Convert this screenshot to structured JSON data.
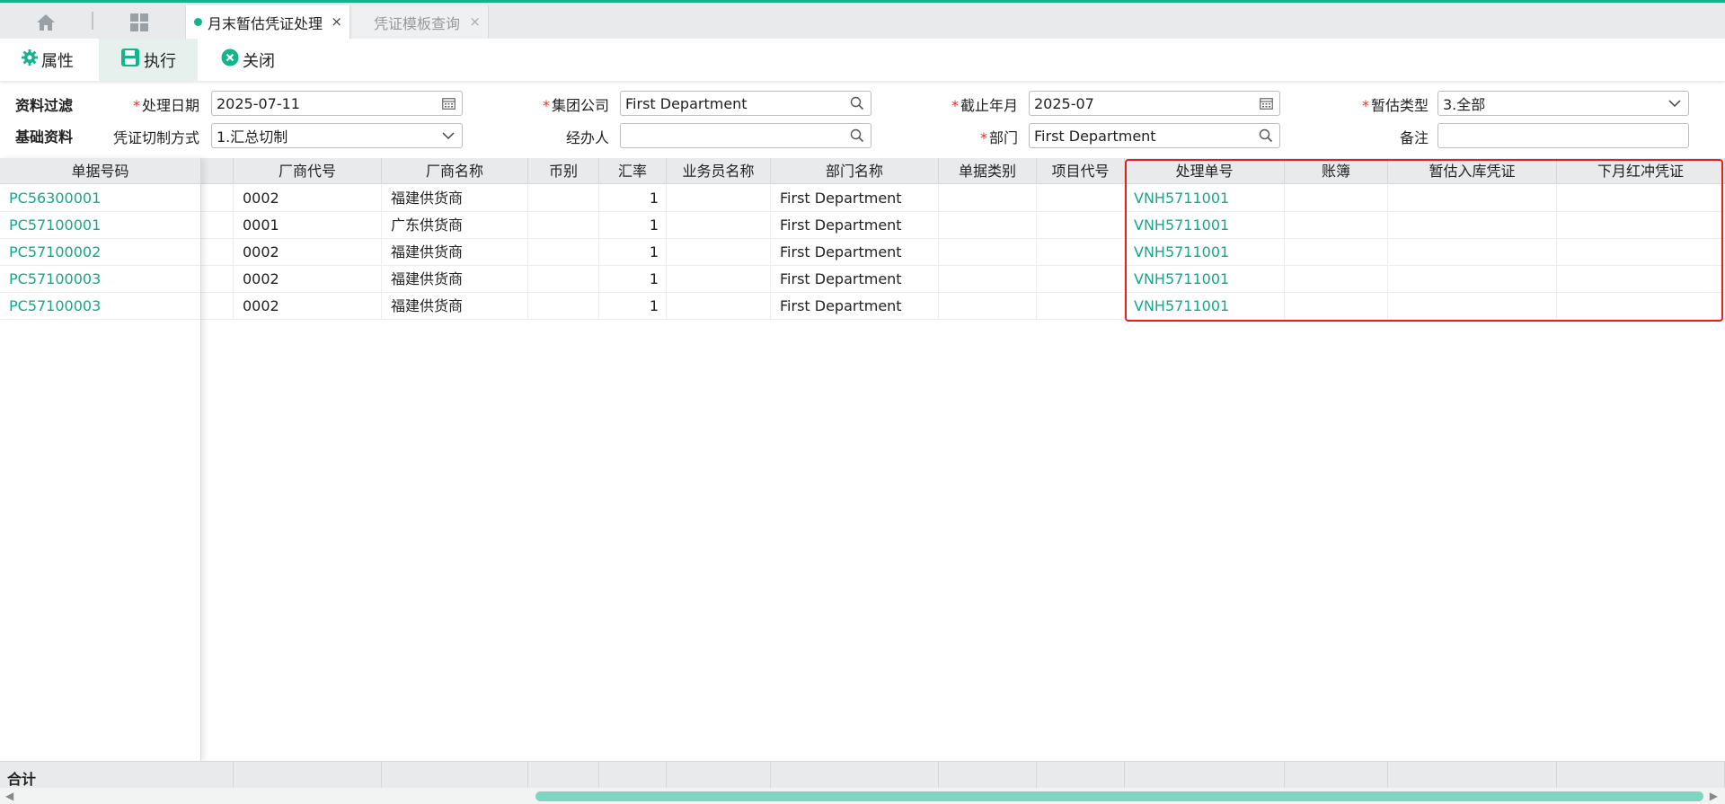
{
  "tabs": {
    "active": {
      "label": "月末暂估凭证处理",
      "close": "×"
    },
    "inactive": {
      "label": "凭证模板查询",
      "close": "×"
    }
  },
  "toolbar": {
    "properties": "属性",
    "execute": "执行",
    "close": "关闭"
  },
  "filter": {
    "section1": "资料过滤",
    "section2": "基础资料",
    "process_date": {
      "label": "处理日期",
      "value": "2025-07-11"
    },
    "group_company": {
      "label": "集团公司",
      "value": "First Department"
    },
    "cutoff_month": {
      "label": "截止年月",
      "value": "2025-07"
    },
    "estimate_type": {
      "label": "暂估类型",
      "value": "3.全部"
    },
    "voucher_mode": {
      "label": "凭证切制方式",
      "value": "1.汇总切制"
    },
    "handler": {
      "label": "经办人",
      "value": ""
    },
    "department": {
      "label": "部门",
      "value": "First Department"
    },
    "remark": {
      "label": "备注",
      "value": ""
    },
    "required_mark": "*"
  },
  "grid": {
    "columns": [
      "单据号码",
      "厂商代号",
      "厂商名称",
      "币别",
      "汇率",
      "业务员名称",
      "部门名称",
      "单据类别",
      "项目代号",
      "处理单号",
      "账簿",
      "暂估入库凭证",
      "下月红冲凭证"
    ],
    "rows": [
      {
        "doc_no": "PC56300001",
        "vendor_code": "0002",
        "vendor_name": "福建供货商",
        "currency": "",
        "rate": "1",
        "salesman": "",
        "dept": "First Department",
        "doc_type": "",
        "project": "",
        "process_no": "VNH5711001",
        "ledger": "",
        "estimate_voucher": "",
        "reverse_voucher": ""
      },
      {
        "doc_no": "PC57100001",
        "vendor_code": "0001",
        "vendor_name": "广东供货商",
        "currency": "",
        "rate": "1",
        "salesman": "",
        "dept": "First Department",
        "doc_type": "",
        "project": "",
        "process_no": "VNH5711001",
        "ledger": "",
        "estimate_voucher": "",
        "reverse_voucher": ""
      },
      {
        "doc_no": "PC57100002",
        "vendor_code": "0002",
        "vendor_name": "福建供货商",
        "currency": "",
        "rate": "1",
        "salesman": "",
        "dept": "First Department",
        "doc_type": "",
        "project": "",
        "process_no": "VNH5711001",
        "ledger": "",
        "estimate_voucher": "",
        "reverse_voucher": ""
      },
      {
        "doc_no": "PC57100003",
        "vendor_code": "0002",
        "vendor_name": "福建供货商",
        "currency": "",
        "rate": "1",
        "salesman": "",
        "dept": "First Department",
        "doc_type": "",
        "project": "",
        "process_no": "VNH5711001",
        "ledger": "",
        "estimate_voucher": "",
        "reverse_voucher": ""
      },
      {
        "doc_no": "PC57100003",
        "vendor_code": "0002",
        "vendor_name": "福建供货商",
        "currency": "",
        "rate": "1",
        "salesman": "",
        "dept": "First Department",
        "doc_type": "",
        "project": "",
        "process_no": "VNH5711001",
        "ledger": "",
        "estimate_voucher": "",
        "reverse_voucher": ""
      }
    ]
  },
  "footer": {
    "total": "合计"
  },
  "colors": {
    "accent": "#13b38b",
    "link": "#13a889",
    "highlight": "#e8201c",
    "required": "#e0302e"
  },
  "icons": [
    "home-icon",
    "grid-icon",
    "gear-icon",
    "save-icon",
    "close-circle-icon",
    "calendar-icon",
    "search-icon",
    "chevron-down-icon"
  ]
}
